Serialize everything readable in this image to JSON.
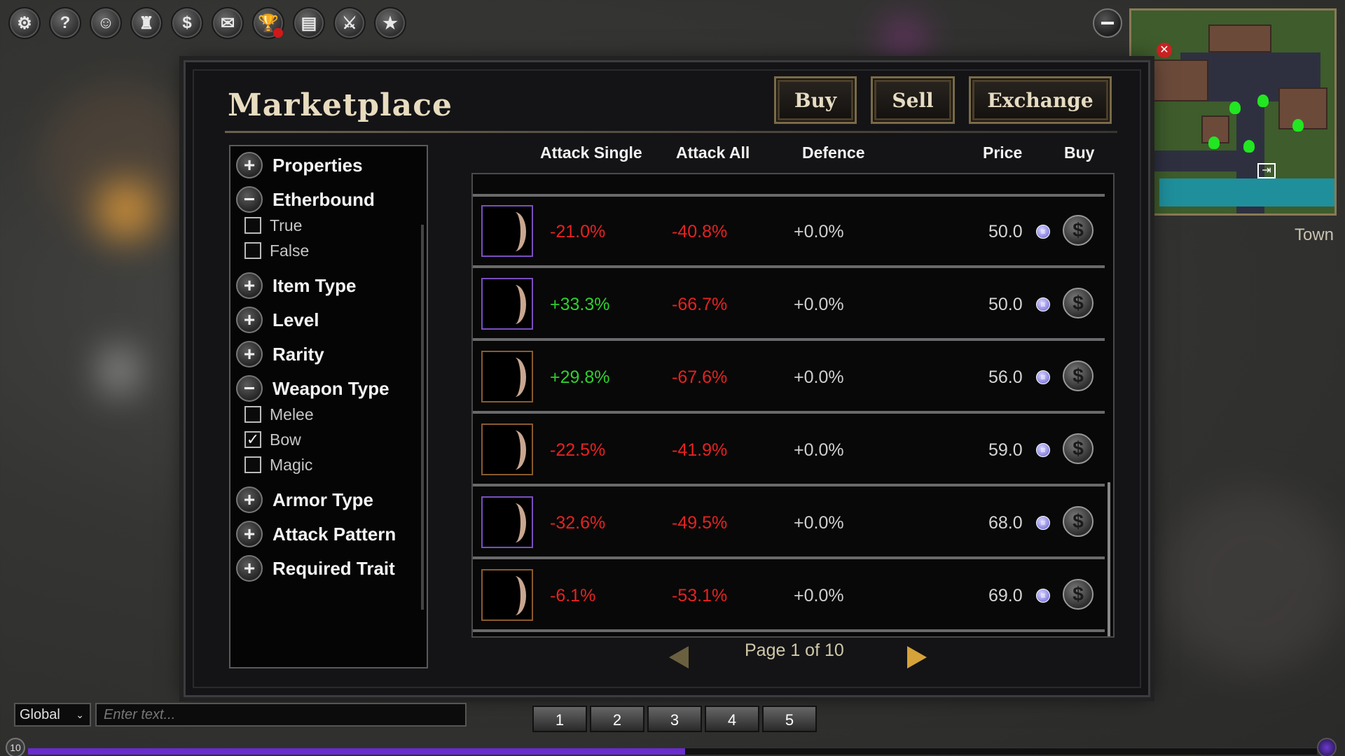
{
  "toolbar": {
    "icons": [
      "settings-icon",
      "help-icon",
      "character-icon",
      "inventory-bag-icon",
      "marketplace-dollar-icon",
      "mail-icon",
      "trophy-icon",
      "quest-scroll-icon",
      "skills-sword-icon",
      "favorites-star-icon"
    ],
    "glyphs": [
      "⚙",
      "?",
      "☺",
      "♜",
      "$",
      "✉",
      "🏆",
      "▤",
      "⚔",
      "★"
    ]
  },
  "minimap": {
    "location_label": "Town"
  },
  "marketplace": {
    "title": "Marketplace",
    "buttons": {
      "buy": "Buy",
      "sell": "Sell",
      "exchange": "Exchange"
    },
    "filters": [
      {
        "label": "Properties",
        "expanded": false
      },
      {
        "label": "Etherbound",
        "expanded": true,
        "options": [
          {
            "label": "True",
            "checked": false
          },
          {
            "label": "False",
            "checked": false
          }
        ]
      },
      {
        "label": "Item Type",
        "expanded": false
      },
      {
        "label": "Level",
        "expanded": false
      },
      {
        "label": "Rarity",
        "expanded": false
      },
      {
        "label": "Weapon Type",
        "expanded": true,
        "options": [
          {
            "label": "Melee",
            "checked": false
          },
          {
            "label": "Bow",
            "checked": true
          },
          {
            "label": "Magic",
            "checked": false
          }
        ]
      },
      {
        "label": "Armor Type",
        "expanded": false
      },
      {
        "label": "Attack Pattern",
        "expanded": false
      },
      {
        "label": "Required Trait",
        "expanded": false
      }
    ],
    "columns": {
      "attack_single": "Attack Single",
      "attack_all": "Attack All",
      "defence": "Defence",
      "price": "Price",
      "buy": "Buy"
    },
    "rows": [
      {
        "attack_single": "-21.0%",
        "attack_all": "-40.8%",
        "defence": "+0.0%",
        "price": "50.0",
        "icon_border": "purple"
      },
      {
        "attack_single": "+33.3%",
        "attack_all": "-66.7%",
        "defence": "+0.0%",
        "price": "50.0",
        "icon_border": "purple"
      },
      {
        "attack_single": "+29.8%",
        "attack_all": "-67.6%",
        "defence": "+0.0%",
        "price": "56.0",
        "icon_border": "brown"
      },
      {
        "attack_single": "-22.5%",
        "attack_all": "-41.9%",
        "defence": "+0.0%",
        "price": "59.0",
        "icon_border": "brown"
      },
      {
        "attack_single": "-32.6%",
        "attack_all": "-49.5%",
        "defence": "+0.0%",
        "price": "68.0",
        "icon_border": "purple"
      },
      {
        "attack_single": "-6.1%",
        "attack_all": "-53.1%",
        "defence": "+0.0%",
        "price": "69.0",
        "icon_border": "brown"
      }
    ],
    "pagination": {
      "text": "Page 1 of 10"
    }
  },
  "chat": {
    "channel": "Global",
    "placeholder": "Enter text..."
  },
  "hotbar": [
    "1",
    "2",
    "3",
    "4",
    "5"
  ],
  "player": {
    "level": "10",
    "xp_fraction": 0.51
  },
  "colors": {
    "negative": "#e62222",
    "positive": "#2ed02e",
    "neutral": "#cfcfcf",
    "xp": "#6a2bd0",
    "accent_gold": "#d6a23a"
  }
}
